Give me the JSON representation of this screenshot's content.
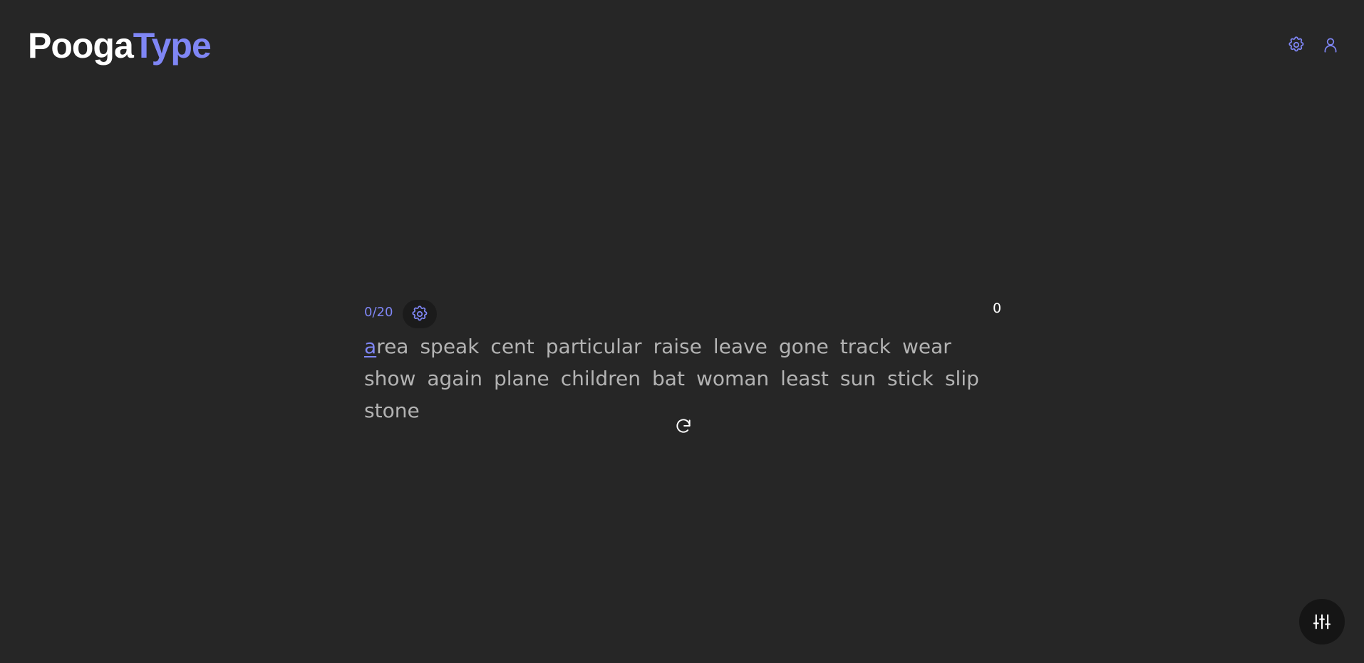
{
  "brand": {
    "name_part1": "Pooga",
    "name_part2": "Type",
    "accent_color": "#7f86f5"
  },
  "header": {
    "icons": [
      "gear-icon",
      "user-icon"
    ]
  },
  "test": {
    "counter": "0/20",
    "wpm": "0",
    "active_letter": "a",
    "first_word_rest": "rea",
    "words": [
      "speak",
      "cent",
      "particular",
      "raise",
      "leave",
      "gone",
      "track",
      "wear",
      "show",
      "again",
      "plane",
      "children",
      "bat",
      "woman",
      "least",
      "sun",
      "stick",
      "slip",
      "stone"
    ],
    "restart_icon": "refresh-icon",
    "settings_icon": "gear-icon"
  },
  "fab": {
    "icon": "sliders-icon"
  }
}
